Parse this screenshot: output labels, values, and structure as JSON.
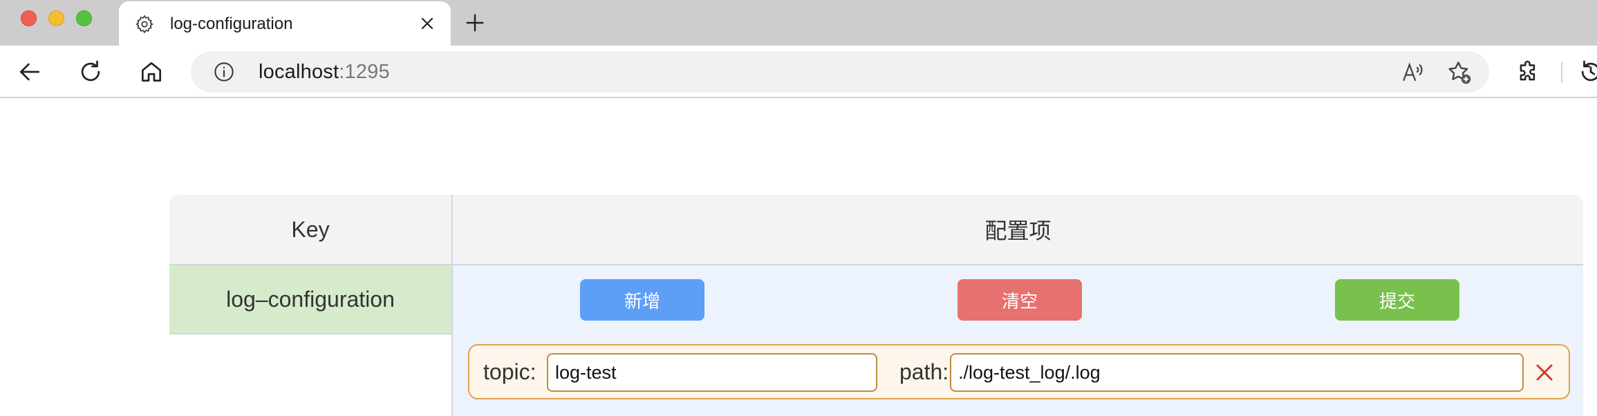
{
  "browser": {
    "tab_title": "log-configuration",
    "url_host": "localhost",
    "url_port": ":1295",
    "icons": {
      "tab": "gear-icon",
      "close": "close-icon",
      "new_tab": "plus-icon",
      "back": "back-arrow-icon",
      "reload": "reload-icon",
      "home": "home-icon",
      "info": "info-icon",
      "read_aloud": "read-aloud-icon",
      "favorite": "favorite-add-icon",
      "extensions": "extensions-icon"
    },
    "colors": {
      "close_dot": "#ee5f58",
      "minimize_dot": "#f6bd2f",
      "maximize_dot": "#56c33f"
    }
  },
  "table": {
    "header_key": "Key",
    "header_config": "配置项",
    "row_key": "log–configuration",
    "buttons": {
      "add": "新增",
      "clear": "清空",
      "submit": "提交"
    },
    "items": [
      {
        "topic_label": "topic:",
        "topic_value": "log-test",
        "path_label": "path:",
        "path_value": "./log-test_log/.log"
      }
    ],
    "colors": {
      "add_button": "#5d9ef7",
      "clear_button": "#e6716e",
      "submit_button": "#79c14d",
      "key_cell_bg": "#d6ebcb",
      "config_cell_bg": "#edf3fc",
      "item_border": "#e3a24a",
      "remove_icon": "#d9362b"
    }
  }
}
